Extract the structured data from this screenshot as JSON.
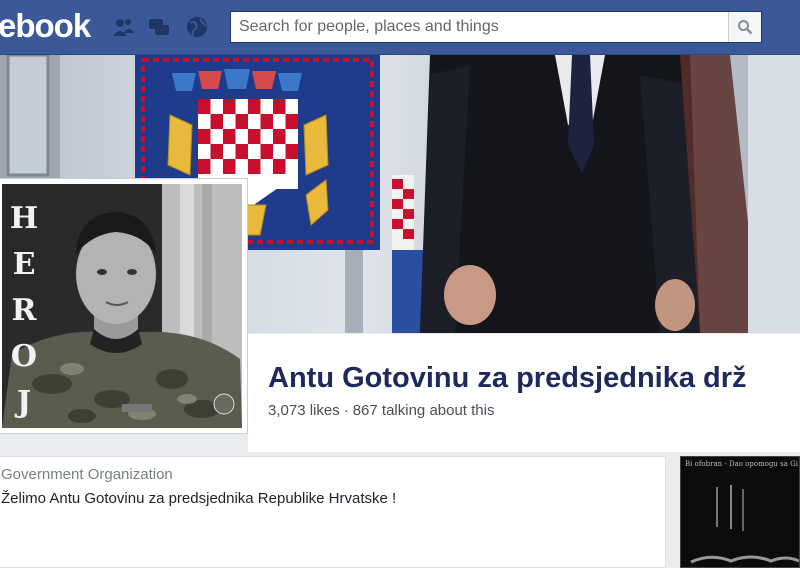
{
  "header": {
    "logo": "ebook",
    "search_placeholder": "Search for people, places and things",
    "icons": [
      "friend-requests-icon",
      "messages-icon",
      "notifications-globe-icon",
      "search-icon"
    ]
  },
  "cover": {
    "description_colors": {
      "flag_blue": "#1f3c8c",
      "flag_red": "#c8102e",
      "suit": "#15161c"
    }
  },
  "profile": {
    "overlay_letters": [
      "H",
      "E",
      "R",
      "O",
      "J"
    ]
  },
  "page": {
    "name": "Antu Gotovinu za predsjednika drž",
    "likes": "3,073 likes",
    "separator": "·",
    "talking": "867 talking about this"
  },
  "about": {
    "category": "Government Organization",
    "description": "Želimo Antu Gotovinu za predsjednika Republike Hrvatske !"
  },
  "side_photo": {
    "caption": "Bi ofobran - Dao opomogu sa Gi"
  },
  "colors": {
    "header_bg": "#3b5998",
    "name_text": "#1d2a5b"
  }
}
